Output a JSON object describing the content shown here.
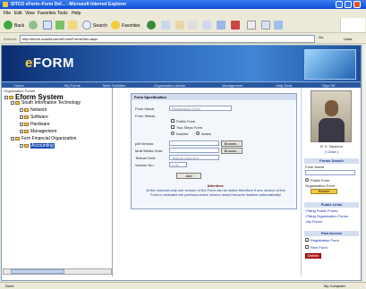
{
  "window": {
    "title": "SITCO eForm–Form Def... - Microsoft Internet Explorer"
  },
  "menu": [
    "File",
    "Edit",
    "View",
    "Favorites",
    "Tools",
    "Help"
  ],
  "toolbar": {
    "back": "Back",
    "search": "Search",
    "favorites": "Favorites"
  },
  "address": {
    "label": "Address",
    "value": "http://eform.sowtht.com/eForm/Forms/Info.aspx",
    "go": "Go",
    "links": "Links"
  },
  "app": {
    "logo_e": "e",
    "logo_rest": "FORM"
  },
  "nav": [
    "Home",
    "My Forms",
    "Table Facilities",
    "Organisation Admin",
    "Management",
    "Help Desk",
    "Sign Off"
  ],
  "tree": {
    "org_label": "Organization Forms",
    "root": "Eform System",
    "nodes": [
      "South Information Technology",
      "Network",
      "Software",
      "Hardware",
      "Management",
      "Fern Financial Organization",
      "Accounting"
    ]
  },
  "form": {
    "header": "Form Specification",
    "name_label": "Form Name:",
    "name_value": "Registration Form",
    "status_label": "Form Status:",
    "public_label": "Public Form",
    "twostep_label": "Two Steps Form",
    "inactive_label": "Inactive",
    "active_label": "Active",
    "pdf_label": "pdf Version:",
    "multimedia_label": "Multi Media Guid:",
    "textual_label": "Textual Guid:",
    "textual_value": "Textual Guid text",
    "version_label": "Version No.:",
    "version_value": "1.00",
    "browse": "Browse...",
    "add": "Add",
    "note_head": "Attention:",
    "note_text": "At the moment only one version of the Form can be active therefore if one version of the Form is activated the previous active version would become inactive automatically!"
  },
  "profile": {
    "name": "R. K. Neshem",
    "link": "[ Close ]"
  },
  "form_search": {
    "header": "Forms Search",
    "field_label": "Form Name",
    "public_label": "Public Form",
    "org_label": "Organization Form",
    "button": "Search"
  },
  "public_links": {
    "header": "Public Links",
    "items": [
      "-Filling Public Forms",
      "-Filling Organization Forms",
      "-My Forms"
    ]
  },
  "fast_access": {
    "header": "Fast Access",
    "items": [
      "Registration Form",
      "Rent Form"
    ],
    "button": "Delete"
  },
  "status": {
    "left": "Done",
    "right": "My Computer"
  }
}
